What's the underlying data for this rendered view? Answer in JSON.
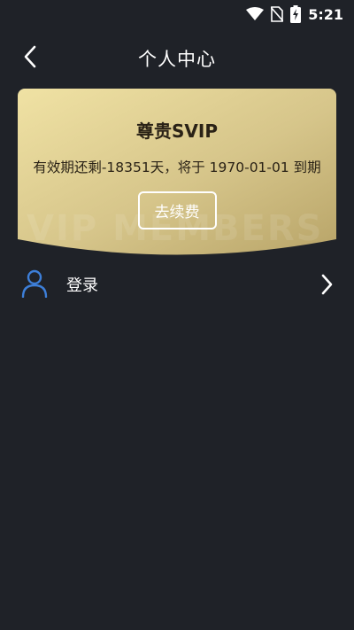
{
  "status_bar": {
    "time": "5:21",
    "icons": [
      "wifi-icon",
      "no-sim-icon",
      "battery-charging-icon"
    ]
  },
  "header": {
    "title": "个人中心",
    "back_icon": "chevron-left-icon"
  },
  "vip_card": {
    "title": "尊贵SVIP",
    "expiry_text": "有效期还剩-18351天，将于 1970-01-01 到期",
    "renew_label": "去续费",
    "watermark": "VIP MEMBERS",
    "colors": {
      "gold_light": "#f0e2a4",
      "gold_dark": "#b8a468"
    }
  },
  "menu": {
    "login": {
      "label": "登录",
      "icon": "user-icon",
      "arrow_icon": "chevron-right-icon"
    }
  },
  "colors": {
    "background": "#1f2228",
    "accent": "#3d7fd9"
  }
}
